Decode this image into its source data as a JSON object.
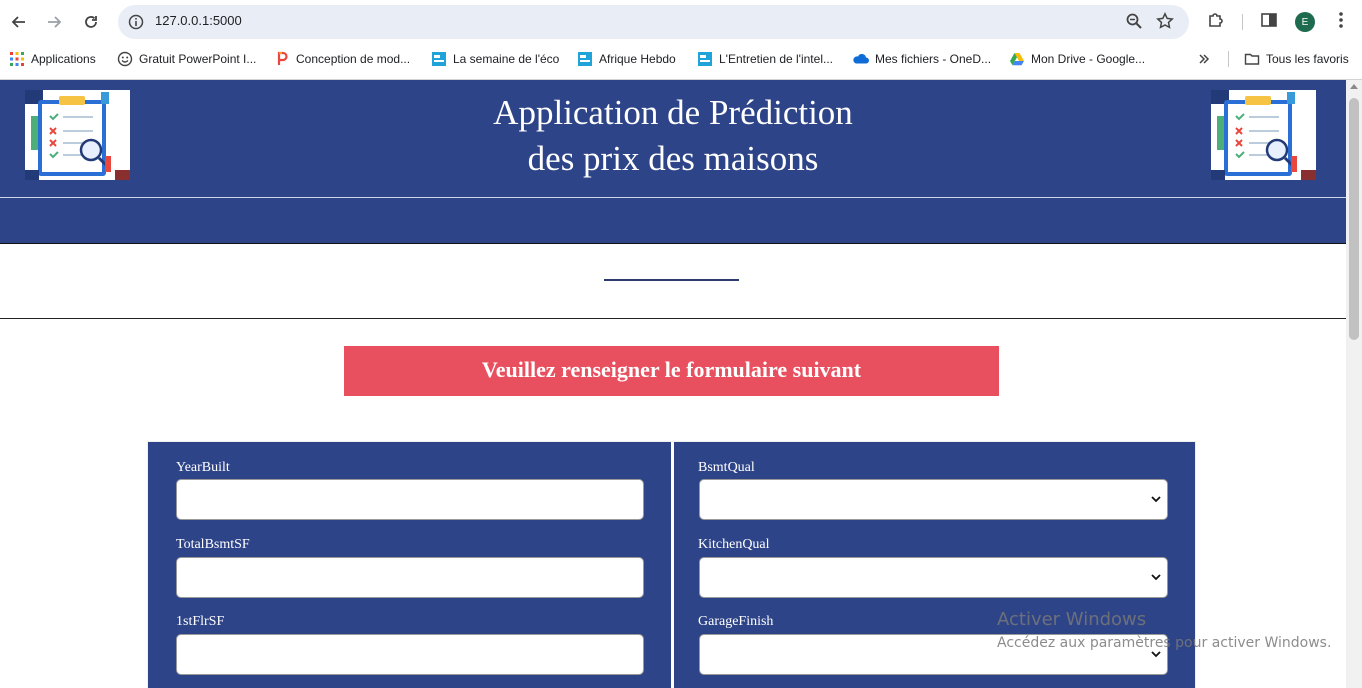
{
  "browser": {
    "url": "127.0.0.1:5000",
    "profile_initial": "E",
    "bookmarks": [
      {
        "label": "Applications",
        "icon": "apps-grid-icon"
      },
      {
        "label": "Gratuit PowerPoint I...",
        "icon": "smiley-icon"
      },
      {
        "label": "Conception de mod...",
        "icon": "p-logo-icon"
      },
      {
        "label": "La semaine de l'éco",
        "icon": "france24-icon"
      },
      {
        "label": "Afrique Hebdo",
        "icon": "france24-icon"
      },
      {
        "label": "L'Entretien de l'intel...",
        "icon": "france24-icon"
      },
      {
        "label": "Mes fichiers - OneD...",
        "icon": "onedrive-cloud-icon"
      },
      {
        "label": "Mon Drive - Google...",
        "icon": "google-drive-icon"
      }
    ],
    "all_bookmarks_label": "Tous les favoris"
  },
  "header": {
    "title_line1": "Application de Prédiction",
    "title_line2": "des prix des maisons"
  },
  "banner": {
    "text": "Veuillez renseigner le formulaire suivant"
  },
  "form": {
    "left_fields": [
      {
        "label": "YearBuilt",
        "value": ""
      },
      {
        "label": "TotalBsmtSF",
        "value": ""
      },
      {
        "label": "1stFlrSF",
        "value": ""
      }
    ],
    "right_fields": [
      {
        "label": "BsmtQual",
        "value": ""
      },
      {
        "label": "KitchenQual",
        "value": ""
      },
      {
        "label": "GarageFinish",
        "value": ""
      }
    ]
  },
  "watermark": {
    "title": "Activer Windows",
    "subtitle": "Accédez aux paramètres pour activer Windows."
  }
}
